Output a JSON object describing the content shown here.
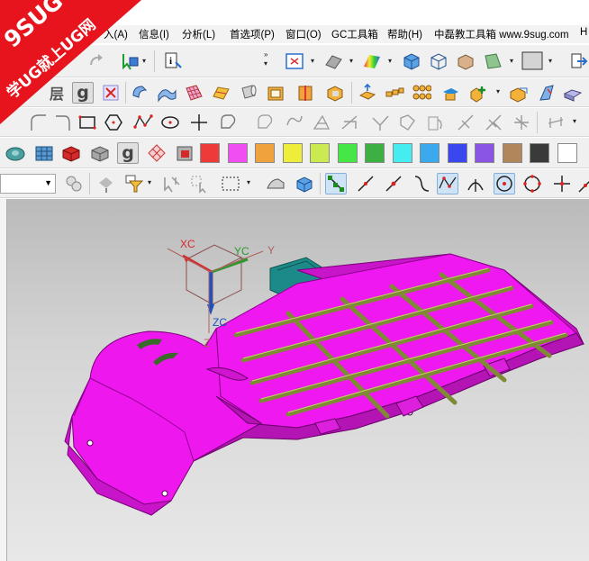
{
  "menubar": {
    "items": [
      "入(A)",
      "信息(I)",
      "分析(L)",
      "首选项(P)",
      "窗口(O)",
      "GC工具箱",
      "帮助(H)",
      "中磊教工具箱 www.9sug.com",
      "H"
    ]
  },
  "watermark": {
    "line1": "9SUG",
    "line2": "学UG就上UG网",
    "color": "#e8141d"
  },
  "toolbar2": {
    "layer_label": "层",
    "g_label": "g"
  },
  "toolbar4": {
    "g_label": "g"
  },
  "palette": {
    "colors": [
      "#ef3a3a",
      "#f04df2",
      "#f0a23c",
      "#eded3a",
      "#cbea52",
      "#46e646",
      "#3cb043",
      "#45edf0",
      "#3aa9ee",
      "#3a46ee",
      "#8a55e4",
      "#b0865a",
      "#3a3a3a",
      "#ffffff"
    ]
  },
  "viewport": {
    "triad": {
      "xc": "XC",
      "yc": "YC",
      "zc": "ZC",
      "y": "Y",
      "z": "Z"
    },
    "part_color": "#ee18ee",
    "rib_color": "#7f8a35"
  }
}
